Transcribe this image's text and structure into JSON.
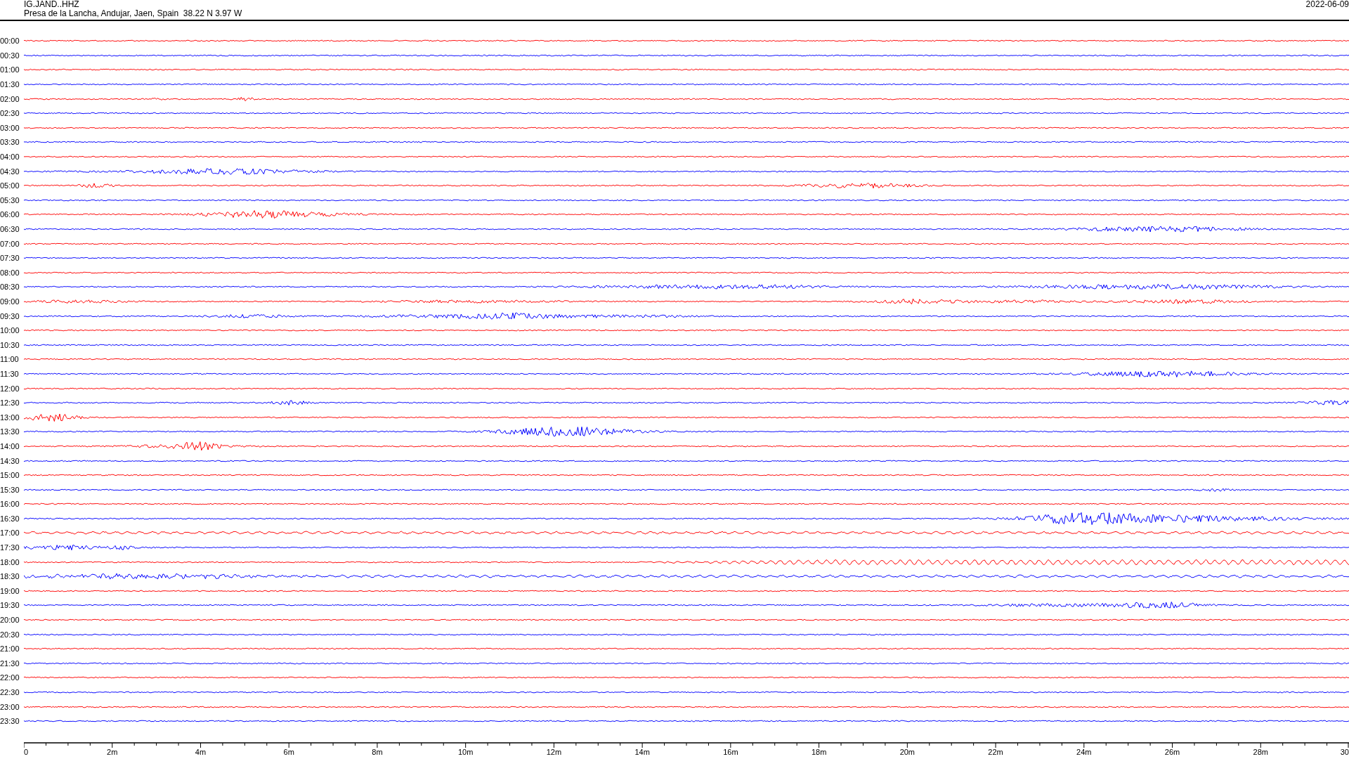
{
  "header": {
    "station": "IG.JAND..HHZ",
    "location": "Presa de la Lancha, Andujar, Jaen, Spain  38.22 N 3.97 W",
    "date": "2022-06-09"
  },
  "rows": [
    {
      "label": "00:00",
      "color": "#ff0000"
    },
    {
      "label": "00:30",
      "color": "#0000ff"
    },
    {
      "label": "01:00",
      "color": "#ff0000"
    },
    {
      "label": "01:30",
      "color": "#0000ff"
    },
    {
      "label": "02:00",
      "color": "#ff0000"
    },
    {
      "label": "02:30",
      "color": "#0000ff"
    },
    {
      "label": "03:00",
      "color": "#ff0000"
    },
    {
      "label": "03:30",
      "color": "#0000ff"
    },
    {
      "label": "04:00",
      "color": "#ff0000"
    },
    {
      "label": "04:30",
      "color": "#0000ff"
    },
    {
      "label": "05:00",
      "color": "#ff0000"
    },
    {
      "label": "05:30",
      "color": "#0000ff"
    },
    {
      "label": "06:00",
      "color": "#ff0000"
    },
    {
      "label": "06:30",
      "color": "#0000ff"
    },
    {
      "label": "07:00",
      "color": "#ff0000"
    },
    {
      "label": "07:30",
      "color": "#0000ff"
    },
    {
      "label": "08:00",
      "color": "#ff0000"
    },
    {
      "label": "08:30",
      "color": "#0000ff"
    },
    {
      "label": "09:00",
      "color": "#ff0000"
    },
    {
      "label": "09:30",
      "color": "#0000ff"
    },
    {
      "label": "10:00",
      "color": "#ff0000"
    },
    {
      "label": "10:30",
      "color": "#0000ff"
    },
    {
      "label": "11:00",
      "color": "#ff0000"
    },
    {
      "label": "11:30",
      "color": "#0000ff"
    },
    {
      "label": "12:00",
      "color": "#ff0000"
    },
    {
      "label": "12:30",
      "color": "#0000ff"
    },
    {
      "label": "13:00",
      "color": "#ff0000"
    },
    {
      "label": "13:30",
      "color": "#0000ff"
    },
    {
      "label": "14:00",
      "color": "#ff0000"
    },
    {
      "label": "14:30",
      "color": "#0000ff"
    },
    {
      "label": "15:00",
      "color": "#ff0000"
    },
    {
      "label": "15:30",
      "color": "#0000ff"
    },
    {
      "label": "16:00",
      "color": "#ff0000"
    },
    {
      "label": "16:30",
      "color": "#0000ff"
    },
    {
      "label": "17:00",
      "color": "#ff0000"
    },
    {
      "label": "17:30",
      "color": "#0000ff"
    },
    {
      "label": "18:00",
      "color": "#ff0000"
    },
    {
      "label": "18:30",
      "color": "#0000ff"
    },
    {
      "label": "19:00",
      "color": "#ff0000"
    },
    {
      "label": "19:30",
      "color": "#0000ff"
    },
    {
      "label": "20:00",
      "color": "#ff0000"
    },
    {
      "label": "20:30",
      "color": "#0000ff"
    },
    {
      "label": "21:00",
      "color": "#ff0000"
    },
    {
      "label": "21:30",
      "color": "#0000ff"
    },
    {
      "label": "22:00",
      "color": "#ff0000"
    },
    {
      "label": "22:30",
      "color": "#0000ff"
    },
    {
      "label": "23:00",
      "color": "#ff0000"
    },
    {
      "label": "23:30",
      "color": "#0000ff"
    }
  ],
  "x_axis": {
    "labels": [
      "0",
      "2m",
      "4m",
      "6m",
      "8m",
      "10m",
      "12m",
      "14m",
      "16m",
      "18m",
      "20m",
      "22m",
      "24m",
      "26m",
      "28m",
      "30"
    ]
  }
}
